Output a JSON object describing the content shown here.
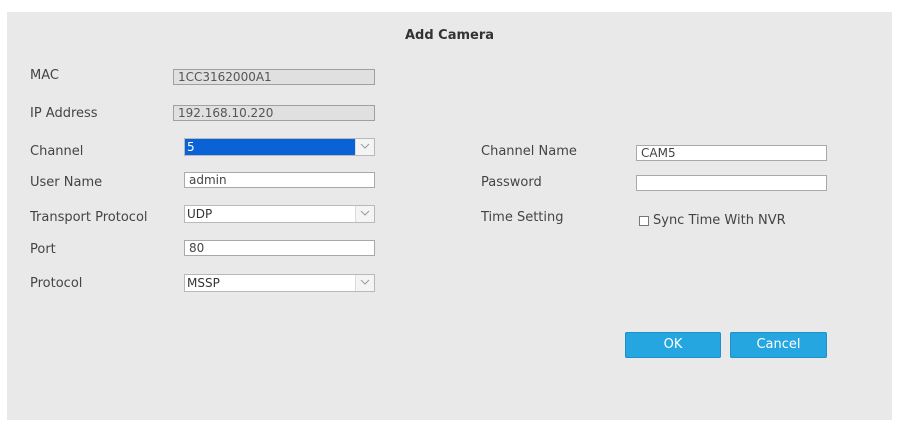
{
  "dialog": {
    "title": "Add Camera"
  },
  "fields": {
    "mac": {
      "label": "MAC",
      "value": "1CC3162000A1"
    },
    "ip": {
      "label": "IP Address",
      "value": "192.168.10.220"
    },
    "channel": {
      "label": "Channel",
      "value": "5"
    },
    "username": {
      "label": "User Name",
      "value": "admin"
    },
    "transport": {
      "label": "Transport Protocol",
      "value": "UDP"
    },
    "port": {
      "label": "Port",
      "value": "80"
    },
    "protocol": {
      "label": "Protocol",
      "value": "MSSP"
    },
    "channel_name": {
      "label": "Channel Name",
      "value": "CAM5"
    },
    "password": {
      "label": "Password",
      "value": ""
    },
    "time_setting": {
      "label": "Time Setting",
      "checkbox_label": "Sync Time With NVR",
      "checked": false
    }
  },
  "buttons": {
    "ok": "OK",
    "cancel": "Cancel"
  },
  "colors": {
    "accent": "#25a6e1",
    "selection": "#0a63d6",
    "background": "#e9e9e9"
  }
}
